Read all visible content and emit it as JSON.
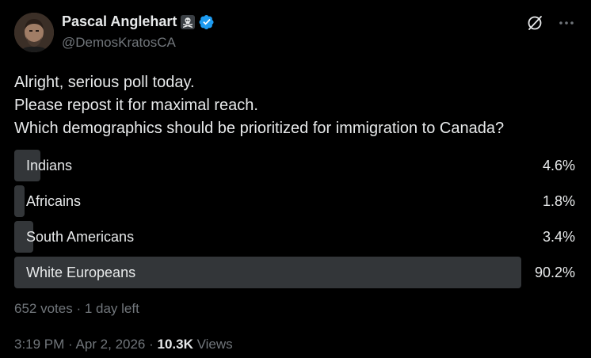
{
  "author": {
    "display_name": "Pascal Anglehart",
    "handle": "@DemosKratosCA",
    "name_emoji": "☠",
    "verified": true
  },
  "tweet": {
    "lines": [
      "Alright, serious poll today.",
      "Please repost it for maximal reach.",
      "Which demographics should be prioritized for immigration to Canada?"
    ]
  },
  "poll": {
    "options": [
      {
        "label": "Indians",
        "percent_text": "4.6%",
        "percent": 4.6
      },
      {
        "label": "Africains",
        "percent_text": "1.8%",
        "percent": 1.8
      },
      {
        "label": "South Americans",
        "percent_text": "3.4%",
        "percent": 3.4
      },
      {
        "label": "White Europeans",
        "percent_text": "90.2%",
        "percent": 90.2
      }
    ],
    "votes": "652 votes",
    "separator": " · ",
    "time_left": "1 day left"
  },
  "meta": {
    "time": "3:19 PM",
    "date": "Apr 2, 2026",
    "separator": " · ",
    "views_count": "10.3K",
    "views_label": "Views"
  },
  "colors": {
    "background": "#000000",
    "text": "#e7e9ea",
    "muted": "#71767b",
    "poll_bar": "#333639",
    "verified": "#1d9bf0"
  },
  "icons": {
    "verified": "verified-badge-icon",
    "grok": "grok-icon",
    "more": "more-icon"
  }
}
